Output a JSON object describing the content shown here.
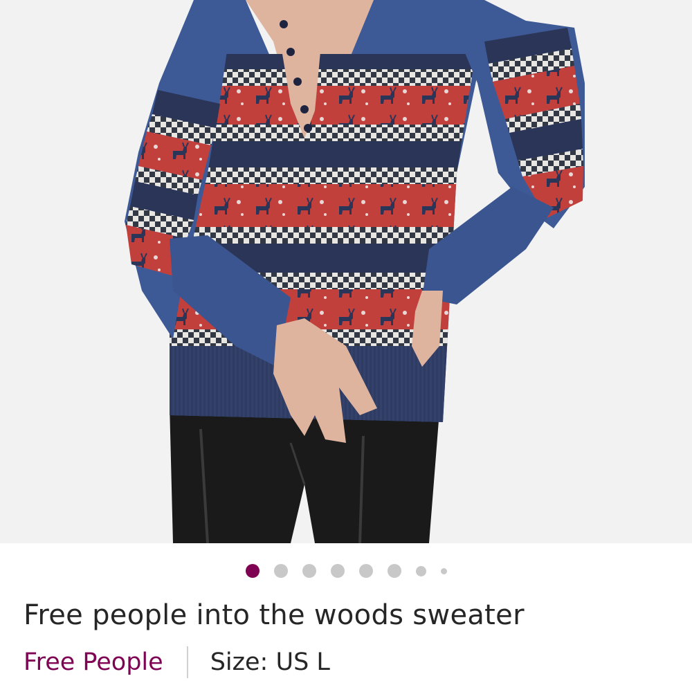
{
  "product": {
    "image_alt": "Model wearing a blue fair isle striped henley sweater with red moose pattern and black leather pants",
    "title": "Free people into the woods sweater",
    "brand": "Free People",
    "size_label": "Size: US L"
  },
  "carousel": {
    "total_dots": 8,
    "active_index": 0
  },
  "colors": {
    "accent": "#7f0353",
    "dot_inactive": "#c8c8c8",
    "text": "#262626",
    "sweater_blue": "#3d5a96",
    "sweater_navy": "#2a3558",
    "pattern_red": "#c2403c"
  }
}
